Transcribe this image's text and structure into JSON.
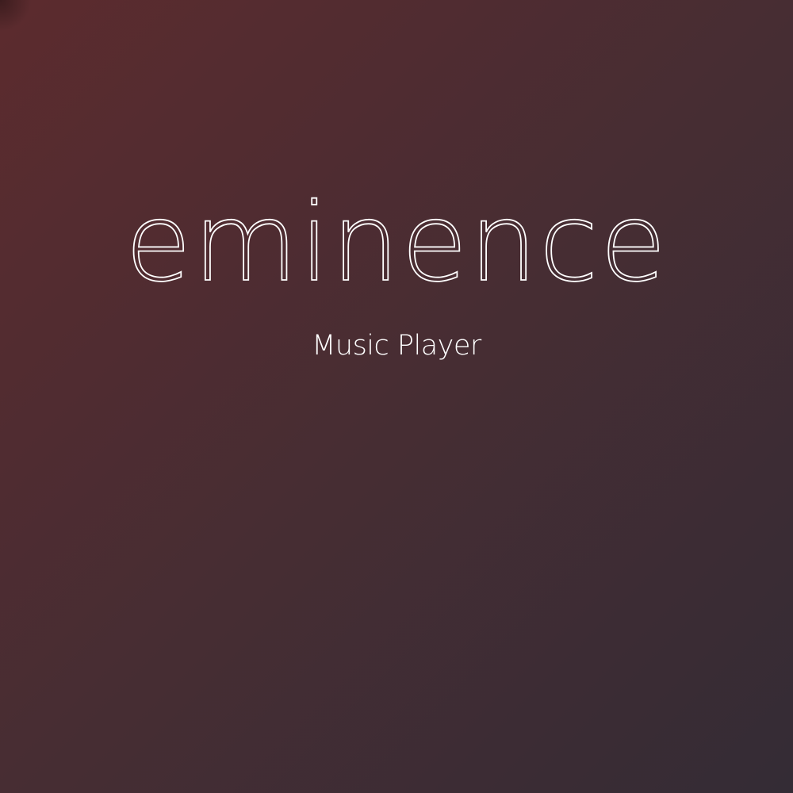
{
  "app": {
    "title": "eminence",
    "subtitle": "Music Player"
  },
  "colors": {
    "gradient_start": "#5c2b2e",
    "gradient_mid": "#472d33",
    "gradient_end": "#342c35",
    "text": "#ffffff"
  }
}
